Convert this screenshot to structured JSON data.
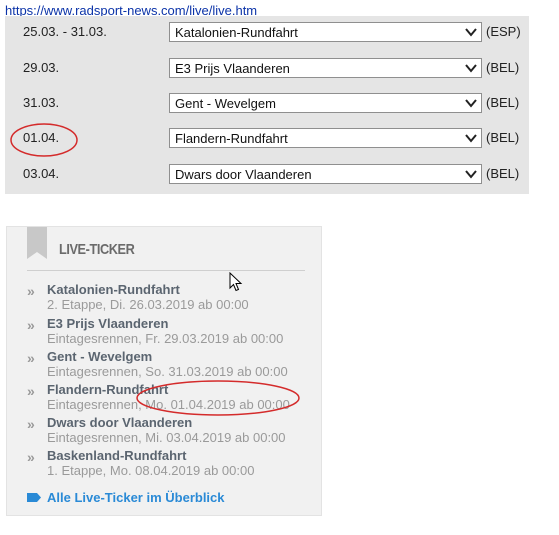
{
  "source_url": "https://www.radsport-news.com/live/live.htm",
  "schedule": [
    {
      "date": "25.03. - 31.03.",
      "race": "Katalonien-Rundfahrt",
      "country": "(ESP)"
    },
    {
      "date": "29.03.",
      "race": "E3 Prijs Vlaanderen",
      "country": "(BEL)"
    },
    {
      "date": "31.03.",
      "race": "Gent - Wevelgem",
      "country": "(BEL)"
    },
    {
      "date": "01.04.",
      "race": "Flandern-Rundfahrt",
      "country": "(BEL)"
    },
    {
      "date": "03.04.",
      "race": "Dwars door Vlaanderen",
      "country": "(BEL)"
    }
  ],
  "ticker": {
    "heading": "LIVE-TICKER",
    "items": [
      {
        "title": "Katalonien-Rundfahrt",
        "sub": "2. Etappe, Di. 26.03.2019 ab 00:00"
      },
      {
        "title": "E3 Prijs Vlaanderen",
        "sub": "Eintagesrennen, Fr. 29.03.2019 ab 00:00"
      },
      {
        "title": "Gent - Wevelgem",
        "sub": "Eintagesrennen, So. 31.03.2019 ab 00:00"
      },
      {
        "title": "Flandern-Rundfahrt",
        "sub": "Eintagesrennen, Mo. 01.04.2019 ab 00:00"
      },
      {
        "title": "Dwars door Vlaanderen",
        "sub": "Eintagesrennen, Mi. 03.04.2019 ab 00:00"
      },
      {
        "title": "Baskenland-Rundfahrt",
        "sub": "1. Etappe, Mo. 08.04.2019 ab 00:00"
      }
    ],
    "all_link": "Alle Live-Ticker im Überblick"
  },
  "icons": {
    "chevron": "»",
    "dropdown": "chevron-down-icon",
    "bookmark": "bookmark-icon",
    "tag": "tag-icon",
    "cursor": "mouse-cursor-icon"
  },
  "colors": {
    "link": "#0b33a8",
    "ticker_link": "#2a8ad6",
    "annotation": "#d42b2b"
  }
}
